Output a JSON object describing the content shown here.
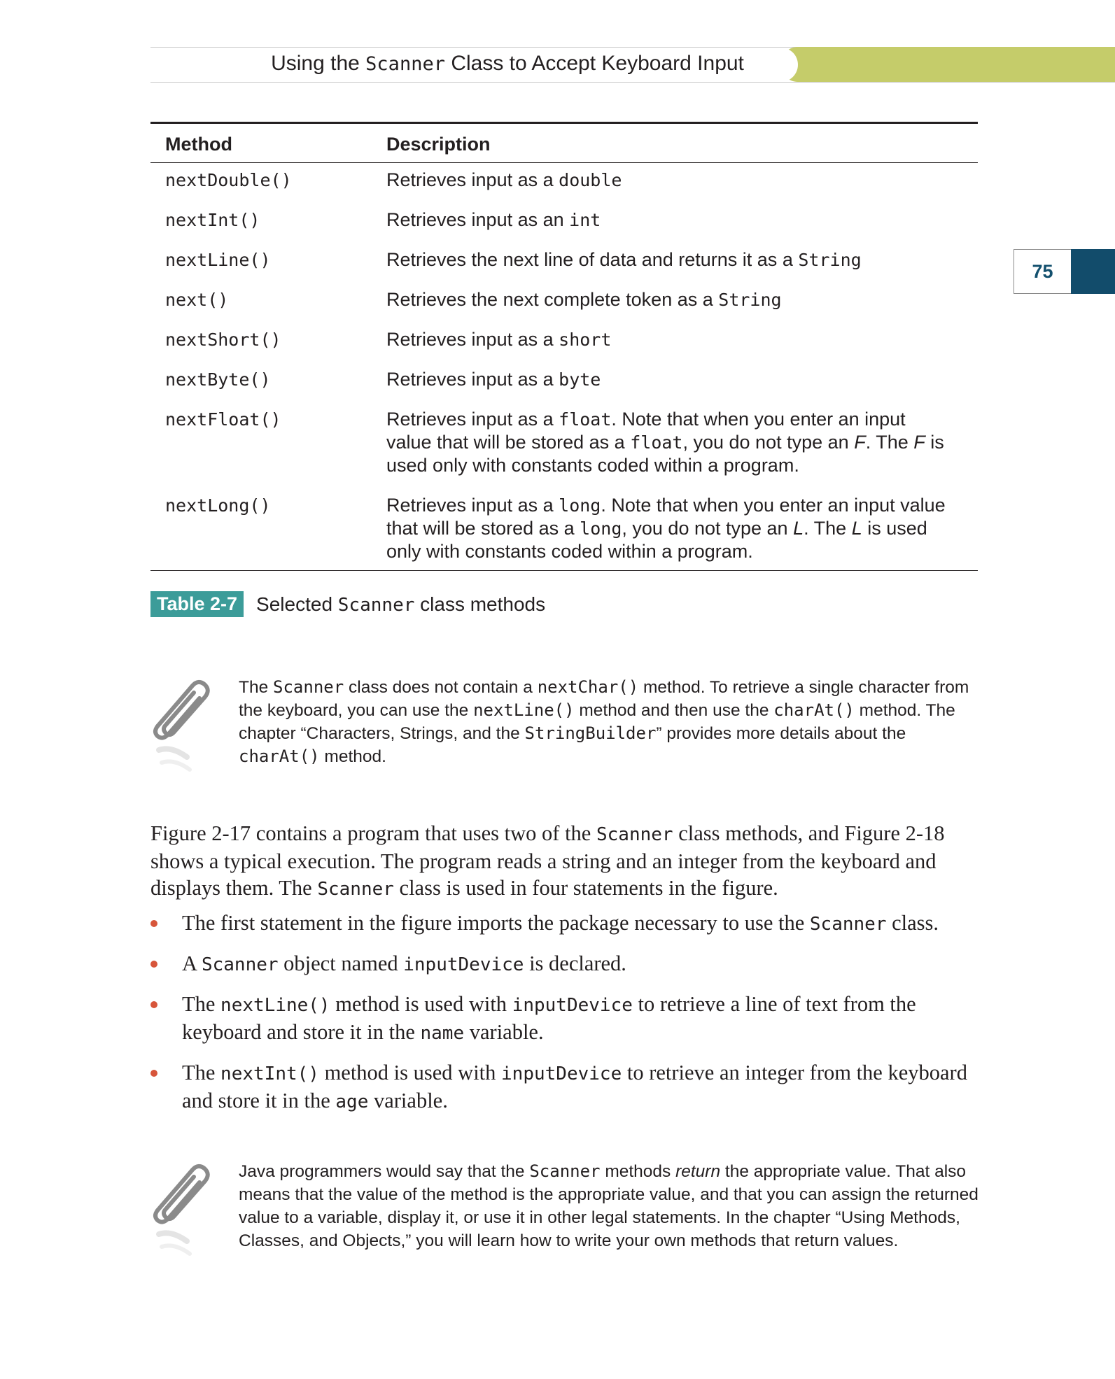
{
  "header": {
    "title_prefix": "Using the",
    "title_code": "Scanner",
    "title_suffix": "Class to Accept Keyboard Input"
  },
  "page_number": "75",
  "table": {
    "col_method": "Method",
    "col_description": "Description",
    "rows": [
      {
        "method": "nextDouble()",
        "desc": "Retrieves input as a",
        "code": "double"
      },
      {
        "method": "nextInt()",
        "desc": "Retrieves input as an",
        "code": "int"
      },
      {
        "method": "nextLine()",
        "desc": "Retrieves the next line of data and returns it as a",
        "code": "String"
      },
      {
        "method": "next()",
        "desc": "Retrieves the next complete token as a",
        "code": "String"
      },
      {
        "method": "nextShort()",
        "desc": "Retrieves input as a",
        "code": "short"
      },
      {
        "method": "nextByte()",
        "desc": "Retrieves input as a",
        "code": "byte"
      },
      {
        "method": "nextFloat()",
        "desc": "Retrieves input as a",
        "code": "float",
        "note1": ". Note that when you enter an input value that will be stored as a",
        "code2": "float",
        "note2": ", you do not type an",
        "letter": "F",
        "note3": ". The",
        "letter2": "F",
        "note4": "is used only with constants coded within a program."
      },
      {
        "method": "nextLong()",
        "desc": "Retrieves input as a",
        "code": "long",
        "note1": ". Note that when you enter an input value that will be stored as a",
        "code2": "long",
        "note2": ", you do not type an",
        "letter": "L",
        "note3": ". The",
        "letter2": "L",
        "note4": "is used only with constants coded within a program."
      }
    ]
  },
  "caption": {
    "label": "Table 2-7",
    "text_prefix": "Selected",
    "text_code": "Scanner",
    "text_suffix": "class methods"
  },
  "note1": {
    "t1": "The",
    "c1": "Scanner",
    "t2": "class does not contain a",
    "c2": "nextChar()",
    "t3": "method. To retrieve a single character from the keyboard, you can use the",
    "c3": "nextLine()",
    "t4": "method and then use the",
    "c4": "charAt()",
    "t5": "method. The chapter “Characters, Strings, and the",
    "c5": "StringBuilder",
    "t6": "” provides more details about the",
    "c6": "charAt()",
    "t7": "method."
  },
  "body": {
    "p1": "Figure 2-17 contains a program that uses two of the",
    "c1": "Scanner",
    "p2": "class methods, and Figure 2-18 shows a typical execution. The program reads a string and an integer from the keyboard and displays them. The",
    "c2": "Scanner",
    "p3": "class is used in four statements in the figure."
  },
  "bullets": {
    "b1": {
      "t1": "The first statement in the figure imports the package necessary to use the",
      "c1": "Scanner",
      "t2": "class."
    },
    "b2": {
      "t1": "A",
      "c1": "Scanner",
      "t2": "object named",
      "c2": "inputDevice",
      "t3": "is declared."
    },
    "b3": {
      "t1": "The",
      "c1": "nextLine()",
      "t2": "method is used with",
      "c2": "inputDevice",
      "t3": "to retrieve a line of text from the keyboard and store it in the",
      "c3": "name",
      "t4": "variable."
    },
    "b4": {
      "t1": "The",
      "c1": "nextInt()",
      "t2": "method is used with",
      "c2": "inputDevice",
      "t3": "to retrieve an integer from the keyboard and store it in the",
      "c3": "age",
      "t4": "variable."
    }
  },
  "note2": {
    "t1": "Java programmers would say that the",
    "c1": "Scanner",
    "t2": "methods",
    "em": "return",
    "t3": "the appropriate value. That also means that the value of the method is the appropriate value, and that you can assign the returned value to a variable, display it, or use it in other legal statements. In the chapter “Using Methods, Classes, and Objects,” you will learn how to write your own methods that return values."
  }
}
